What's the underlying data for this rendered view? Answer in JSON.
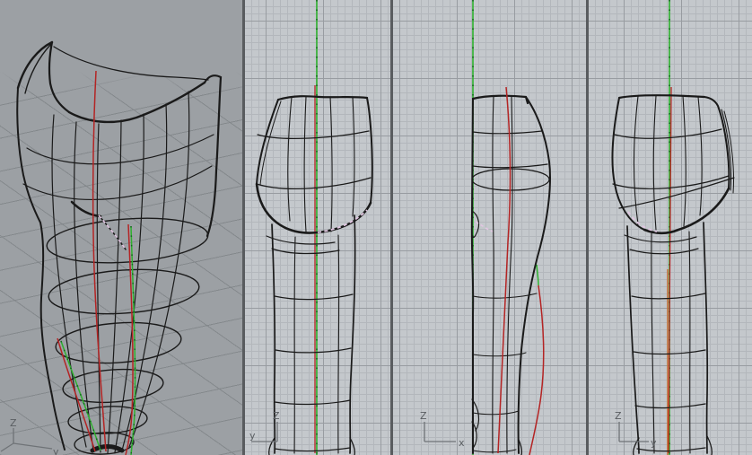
{
  "app": {
    "description": "four-viewport CAD wireframe model view"
  },
  "viewports": [
    {
      "gizmo_up": "Z",
      "gizmo_axis": "y"
    },
    {
      "gizmo_up": "Z",
      "gizmo_axis": "y"
    },
    {
      "gizmo_up": "Z",
      "gizmo_axis": "x"
    },
    {
      "gizmo_up": "Z",
      "gizmo_axis": "y"
    }
  ],
  "colors": {
    "perspective_background": "#9ca0a4",
    "ortho_background": "#c4c8cc",
    "grid_minor": "#b3b7bc",
    "grid_major": "#989ca1",
    "wireframe_black": "#1a1a1a",
    "curve_green": "#2eb12e",
    "curve_red": "#b42424",
    "curve_orange": "#c8641e",
    "seam_dashed_pink": "#e2c6e2",
    "gizmo_gray": "#6f7377",
    "divider_gray": "#595c5f"
  }
}
